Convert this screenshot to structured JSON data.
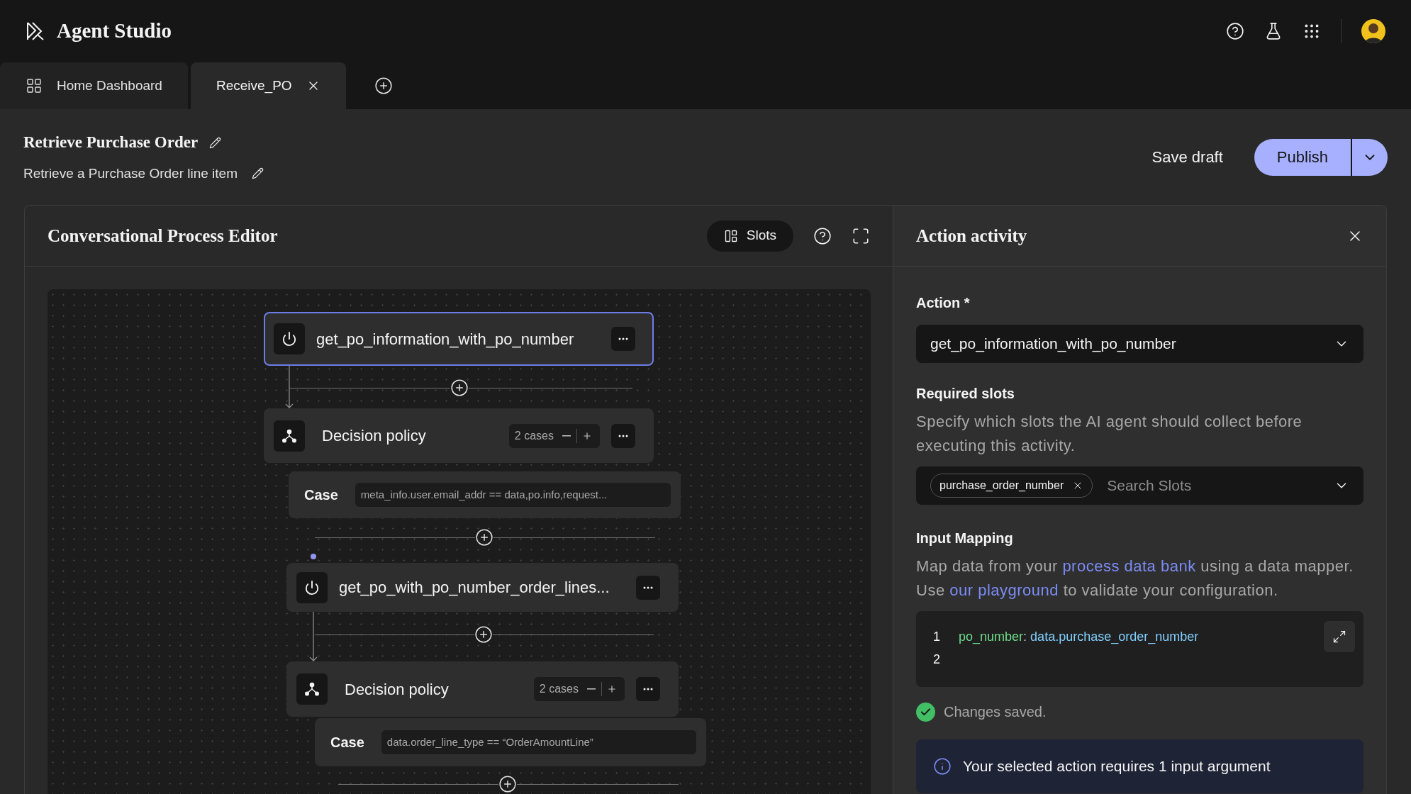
{
  "app": {
    "title": "Agent Studio"
  },
  "tabs": [
    {
      "label": "Home Dashboard",
      "selected": false,
      "closable": false
    },
    {
      "label": "Receive_PO",
      "selected": true,
      "closable": true
    }
  ],
  "page": {
    "title": "Retrieve Purchase Order",
    "subtitle": "Retrieve a Purchase Order line item",
    "save": "Save draft",
    "publish": "Publish"
  },
  "editor": {
    "title": "Conversational Process Editor",
    "slots_button": "Slots",
    "nodes": [
      {
        "kind": "action",
        "label": "get_po_information_with_po_number",
        "selected": true
      },
      {
        "kind": "decision",
        "label": "Decision policy",
        "cases": "2 cases",
        "selected": false
      },
      {
        "kind": "case",
        "label": "Case",
        "condition": "meta_info.user.email_addr == data,po.info,request...",
        "selected": false
      },
      {
        "kind": "action",
        "label": "get_po_with_po_number_order_lines...",
        "selected": false
      },
      {
        "kind": "decision",
        "label": "Decision policy",
        "cases": "2 cases",
        "selected": false
      },
      {
        "kind": "case",
        "label": "Case",
        "condition": "data.order_line_type == “OrderAmountLine”",
        "selected": false
      }
    ]
  },
  "panel": {
    "title": "Action activity",
    "action_label": "Action *",
    "action_value": "get_po_information_with_po_number",
    "slots_label": "Required slots",
    "slots_description": "Specify which slots the AI agent should collect before executing this activity.",
    "slot_tags": [
      "purchase_order_number"
    ],
    "slots_placeholder": "Search Slots",
    "mapping_label": "Input Mapping",
    "mapping_description": [
      {
        "kind": "text",
        "text": "Map data from your "
      },
      {
        "kind": "link",
        "text": "process data bank"
      },
      {
        "kind": "text",
        "text": " using a data mapper. Use "
      },
      {
        "kind": "link",
        "text": "our playground"
      },
      {
        "kind": "text",
        "text": " to validate your configuration."
      }
    ],
    "code_lines": [
      {
        "number": "1",
        "key": "po_number",
        "separator": ":",
        "value": "data.purchase_order_number"
      },
      {
        "number": "2"
      }
    ],
    "status": "Changes saved.",
    "info": "Your selected action requires 1 input argument"
  }
}
